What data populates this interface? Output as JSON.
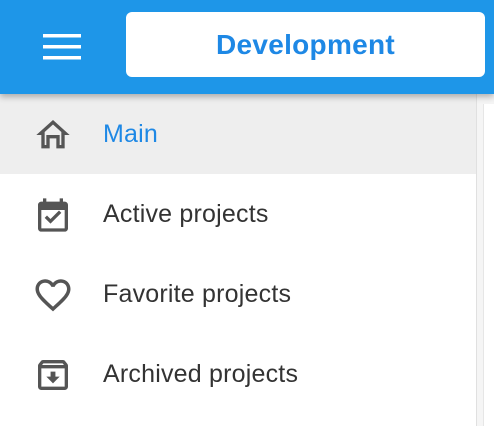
{
  "header": {
    "menu_icon": "hamburger-menu-icon",
    "project_name": "Development",
    "background_color": "#1e96e8",
    "accent_color": "#1e88e5"
  },
  "drawer": {
    "items": [
      {
        "label": "Main",
        "icon": "home-icon",
        "active": true
      },
      {
        "label": "Active projects",
        "icon": "calendar-check-icon",
        "active": false
      },
      {
        "label": "Favorite projects",
        "icon": "heart-icon",
        "active": false
      },
      {
        "label": "Archived projects",
        "icon": "archive-icon",
        "active": false
      }
    ]
  }
}
